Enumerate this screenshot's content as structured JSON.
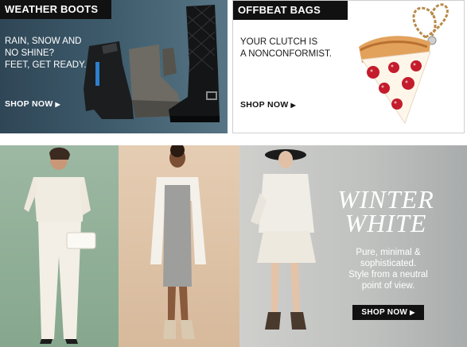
{
  "promos": [
    {
      "tag": "WEATHER BOOTS",
      "lines": [
        "RAIN, SNOW AND",
        "NO SHINE?",
        "FEET, GET READY."
      ],
      "link": "SHOP NOW",
      "image": "rain-boots-image"
    },
    {
      "tag": "OFFBEAT BAGS",
      "lines": [
        "YOUR CLUTCH IS",
        "A NONCONFORMIST."
      ],
      "link": "SHOP NOW",
      "image": "pizza-clutch-image"
    }
  ],
  "banner": {
    "headline": [
      "WINTER",
      "WHITE"
    ],
    "tagline": [
      "Pure, minimal &",
      "sophisticated.",
      "Style from a neutral",
      "point of view."
    ],
    "button": "SHOP NOW",
    "images": [
      "model-white-pantsuit",
      "model-grey-dress",
      "model-white-coat"
    ]
  },
  "colors": {
    "tag_background": "#111111",
    "boots_background": "#3d5a6b",
    "panel_green": "#9db8a3",
    "panel_tan": "#e5cdb3",
    "panel_grey": "#c0c2c0"
  }
}
